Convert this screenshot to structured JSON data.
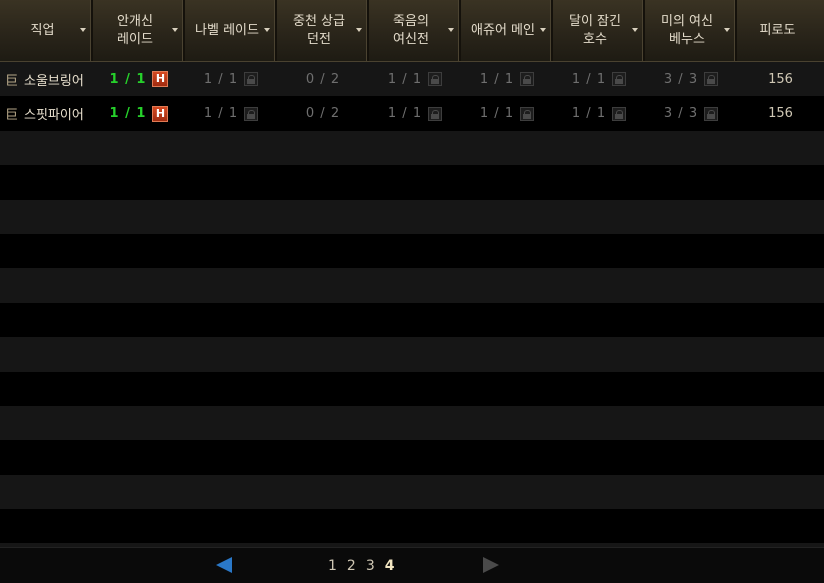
{
  "columns": [
    {
      "label": "직업"
    },
    {
      "label": "안개신\n레이드"
    },
    {
      "label": "나벨 레이드"
    },
    {
      "label": "중천 상급\n던전"
    },
    {
      "label": "죽음의\n여신전"
    },
    {
      "label": "애쥬어 메인"
    },
    {
      "label": "달이 잠긴\n호수"
    },
    {
      "label": "미의 여신\n베누스"
    },
    {
      "label": "피로도"
    }
  ],
  "rows": [
    {
      "class_icon": "巨",
      "name": "소울브링어",
      "fog_raid": "1 / 1",
      "fog_badge": "H",
      "nabel": "1 / 1",
      "jungcheon": "0 / 2",
      "death_goddess": "1 / 1",
      "azure": "1 / 1",
      "moon_lake": "1 / 1",
      "venus": "3 / 3",
      "fatigue": "156"
    },
    {
      "class_icon": "巨",
      "name": "스핏파이어",
      "fog_raid": "1 / 1",
      "fog_badge": "H",
      "nabel": "1 / 1",
      "jungcheon": "0 / 2",
      "death_goddess": "1 / 1",
      "azure": "1 / 1",
      "moon_lake": "1 / 1",
      "venus": "3 / 3",
      "fatigue": "156"
    }
  ],
  "pagination": {
    "pages": [
      "1",
      "2",
      "3",
      "4"
    ],
    "current": "4"
  }
}
